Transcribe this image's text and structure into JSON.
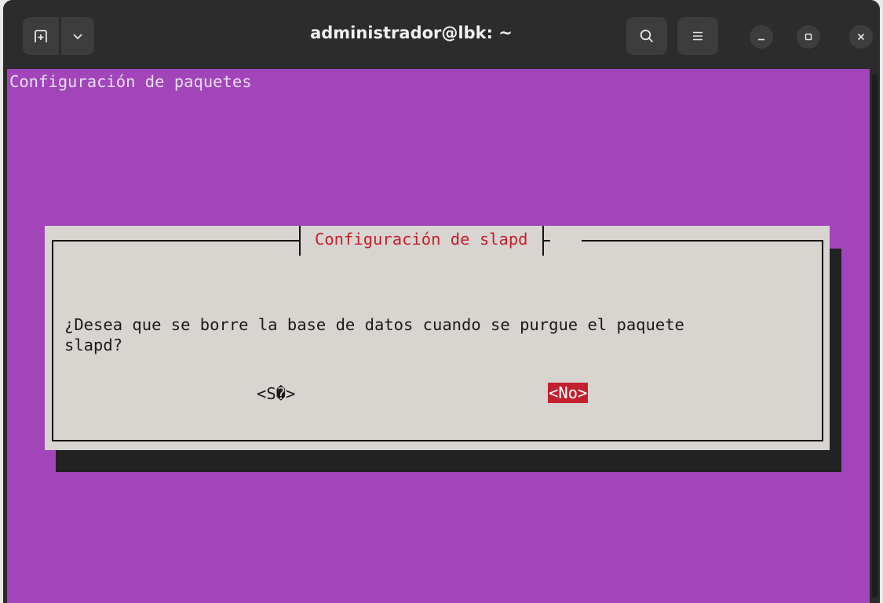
{
  "window": {
    "title": "administrador@lbk: ~"
  },
  "icons": {
    "new_tab": "new-tab-icon",
    "tab_menu": "chevron-down-icon",
    "search": "search-icon",
    "menu": "hamburger-menu-icon",
    "minimize": "minimize-icon",
    "maximize": "maximize-icon",
    "close": "close-icon"
  },
  "terminal": {
    "header": "Configuración de paquetes",
    "background_color": "#a245bb"
  },
  "dialog": {
    "title": "Configuración de slapd",
    "question": "¿Desea que se borre la base de datos cuando se purgue el paquete\nslapd?",
    "yes_label": "<S�>",
    "no_label": "<No>",
    "selected": "no",
    "accent_color": "#c3202f"
  }
}
